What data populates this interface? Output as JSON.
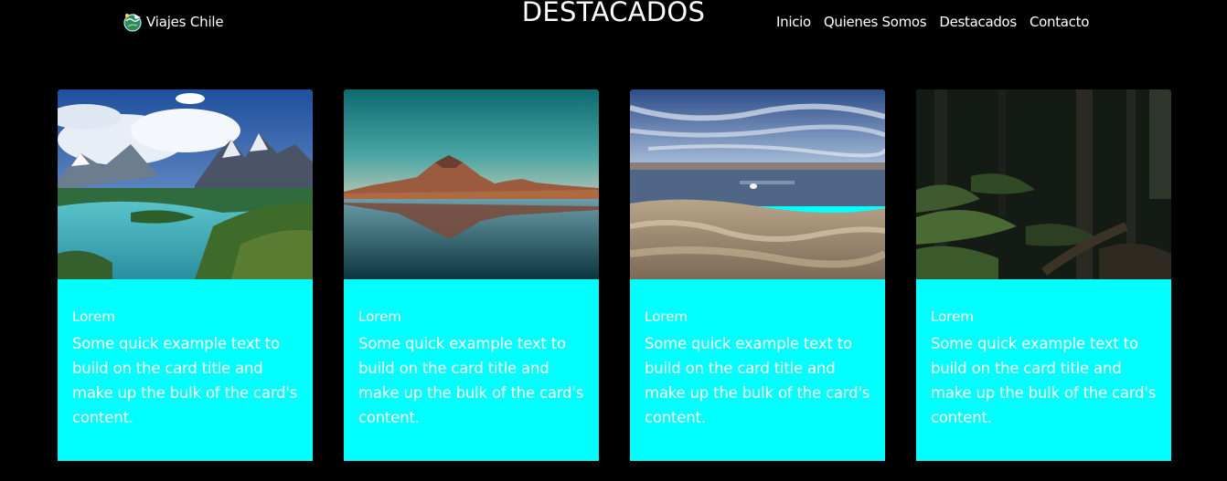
{
  "brand": {
    "name": "Viajes Chile",
    "logo_icon": "travel-globe-logo-icon"
  },
  "section": {
    "title": "DESTACADOS"
  },
  "nav": {
    "items": [
      {
        "label": "Inicio"
      },
      {
        "label": "Quienes Somos"
      },
      {
        "label": "Destacados"
      },
      {
        "label": "Contacto"
      }
    ]
  },
  "colors": {
    "background": "#000000",
    "card_background": "#00ffff",
    "text": "#ffffff"
  },
  "cards": [
    {
      "image": "torres-del-paine-lake-photo",
      "title": "Lorem",
      "text": "Some quick example text to build on the card title and make up the bulk of the card's content."
    },
    {
      "image": "volcano-lake-reflection-photo",
      "title": "Lorem",
      "text": "Some quick example text to build on the card title and make up the bulk of the card's content."
    },
    {
      "image": "salt-flat-lagoon-photo",
      "title": "Lorem",
      "text": "Some quick example text to build on the card title and make up the bulk of the card's content."
    },
    {
      "image": "forest-fern-trail-photo",
      "title": "Lorem",
      "text": "Some quick example text to build on the card title and make up the bulk of the card's content."
    }
  ]
}
